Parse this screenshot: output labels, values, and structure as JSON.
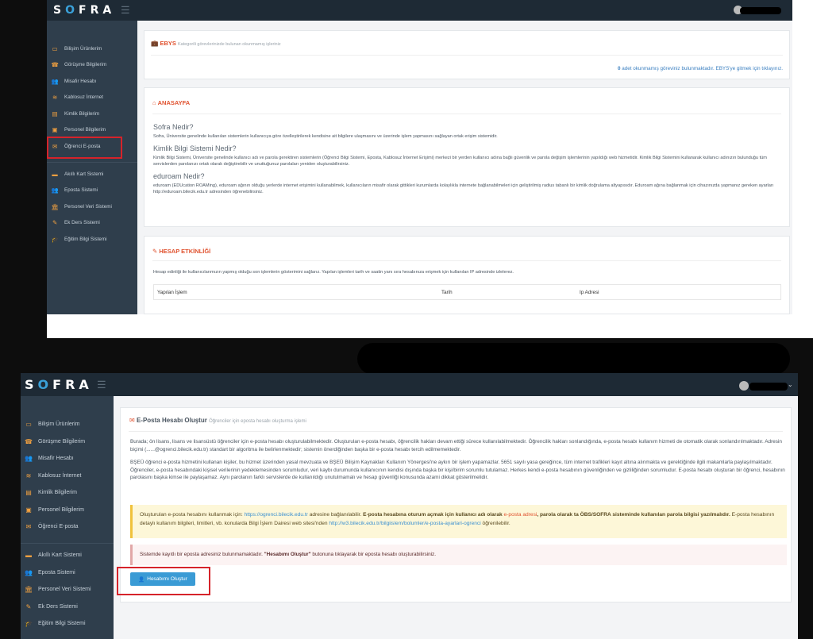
{
  "app": {
    "logo": "SOFRA"
  },
  "sidebar": {
    "items": [
      {
        "label": "Bilişim Ürünlerim",
        "icon": "laptop-icon"
      },
      {
        "label": "Görüşme Bilgilerim",
        "icon": "phone-icon"
      },
      {
        "label": "Misafir Hesabı",
        "icon": "users-icon"
      },
      {
        "label": "Kablosuz İnternet",
        "icon": "wifi-icon"
      },
      {
        "label": "Kimlik Bilgilerim",
        "icon": "id-card-icon"
      },
      {
        "label": "Personel Bilgilerim",
        "icon": "briefcase-icon"
      },
      {
        "label": "Öğrenci E-posta",
        "icon": "envelope-icon"
      }
    ],
    "items2": [
      {
        "label": "Akıllı Kart Sistemi",
        "icon": "credit-card-icon"
      },
      {
        "label": "Eposta Sistemi",
        "icon": "users-icon"
      },
      {
        "label": "Personel Veri Sistemi",
        "icon": "bank-icon"
      },
      {
        "label": "Ek Ders Sistemi",
        "icon": "pencil-icon"
      },
      {
        "label": "Eğitim Bilgi Sistemi",
        "icon": "graduation-icon"
      }
    ]
  },
  "screen1": {
    "ebys": {
      "title": "EBYS",
      "subtitle": "Kategorili görevlerinizde bulunan okunmamış işleriniz",
      "count": "0",
      "message": "adet okunmamış göreviniz bulunmaktadır. EBYS'ye gitmek için tıklayınız."
    },
    "home": {
      "title": "ANASAYFA",
      "q1": "Sofra Nedir?",
      "a1": "Sofra, Üniversite genelinde kullanılan sistemlerin kullanıcıya göre özelleştirilerek kendisine ait bilgilere ulaşmasını ve üzerinde işlem yapmasını sağlayan ortak erişim sistemidir.",
      "q2": "Kimlik Bilgi Sistemi Nedir?",
      "a2": "Kimlik Bilgi Sistemi, Üniversite genelinde kullanıcı adı ve parola gerektiren sistemlerin (Öğrenci Bilgi Sistemi, Eposta, Kablosuz İnternet Erişimi) merkezi bir yerden kullanıcı adına bağlı güvenlik ve parola değişim işlemlerinin yapıldığı web hizmetidir. Kimlik Bilgi Sistemini kullanarak kullanıcı adınızın bulunduğu tüm servislerden parolanızı ortak olarak değiştirebilir ve unuttuğunuz parolaları yeniden oluşturabilirsiniz.",
      "q3": "eduroam Nedir?",
      "a3": "eduroam (EDUcation ROAMing), eduroam ağının olduğu yerlerde internet erişimini kullanabilmek, kullanıcıların misafir olarak gittikleri kurumlarda kolaylıkla internete bağlanabilmeleri için geliştirilmiş radius tabanlı bir kimlik doğrulama altyapısıdır. Eduroam ağına bağlanmak için cihazınızda yapmanız gereken ayarları http://eduroam.bilecik.edu.tr adresinden öğrenebilirsiniz."
    },
    "activity": {
      "title": "HESAP ETKİNLİĞİ",
      "desc": "Hesap edinliği ile kullanıcılarımızın yapmış olduğu son işlemlerin gösterimini sağlarız. Yapılan işlemleri tarih ve saatin yanı sıra hesabınıza erişmek için kullanılan IP adresinde izlelerez.",
      "columns": [
        "Yapılan İşlem",
        "Tarih",
        "Ip Adresi"
      ]
    }
  },
  "screen2": {
    "panel": {
      "title": "E-Posta Hesabı Oluştur",
      "subtitle": "Öğrenciler için eposta hesabı oluşturma işlemi",
      "p1": "Burada; ön lisans, lisans ve lisansüstü öğrenciler için e-posta hesabı oluşturulabilmektedir. Oluşturulan e-posta hesabı, öğrencilik hakları devam ettiği sürece kullanılabilmektedir. Öğrencilik hakları sonlandığında, e-posta hesabı kullanım hizmeti de otomatik olarak sonlandırılmaktadır. Adresin biçimi (......@ogrenci.bilecik.edu.tr) standart bir algoritma ile belirlenmektedir; sistemin önerdiğinden başka bir e-posta hesabı tercih edilmemektedir.",
      "p2": "BŞEÜ öğrenci e-posta hizmetini kullanan kişiler, bu hizmet üzerinden yasal mevzuata ve BŞEÜ Bilişim Kaynakları Kullanım Yönergesi'ne aykırı bir işlem yapamazlar. 5651 sayılı yasa gereğince, tüm internet trafikleri kayıt altına alınmakta ve gerektiğinde ilgili makamlarla paylaşılmaktadır. Öğrenciler, e-posta hesabındaki kişisel verilerinin yedeklemesinden sorumludur, veri kaybı durumunda kullanıcının kendisi dışında başka bir kişi/birim sorumlu tutulamaz. Herkes kendi e-posta hesabının güvenliğinden ve gizliliğinden sorumludur. E-posta hesabı oluşturan bir öğrenci, hesabının parolasını başka kimse ile paylaşamaz. Aynı parolanın farklı servislerde de kullanıldığı unutulmamalı ve hesap güvenliği konusunda azami dikkat gösterilmelidir.",
      "info_a": "Oluşturulan e-posta hesabını kullanmak için:",
      "info_link1": "https://ogrenci.bilecik.edu.tr",
      "info_b": "adresine bağlanılabilir.",
      "info_bold1": "E-posta hesabına oturum açmak için kullanıcı adı olarak",
      "info_orange": "e-posta adresi",
      "info_bold2": ", parola olarak ta ÖBS/SOFRA sisteminde kullanılan parola bilgisi yazılmalıdır.",
      "info_c": "E-posta hesabının detaylı kullanım bilgileri, limitleri, vb. konularda Bilgi İşlem Dairesi web sitesi'nden",
      "info_link2": "http://w3.bilecik.edu.tr/bilgiislem/bolumler/e-posta-ayarlari-ogrenci",
      "info_d": "öğrenilebilir.",
      "warn_a": "Sistemde kayıtlı bir eposta adresiniz bulunmamaktadır.",
      "warn_bold": "\"Hesabımı Oluştur\"",
      "warn_b": "butonuna tıklayarak bir eposta hesabı oluşturabilirsiniz.",
      "button": "Hesabımı Oluştur"
    }
  },
  "colors": {
    "accent": "#3a9bd5",
    "brand_orange": "#e0522f",
    "sidebar": "#2f3e4c",
    "topbar": "#1e2a35",
    "highlight": "#d6232a"
  }
}
